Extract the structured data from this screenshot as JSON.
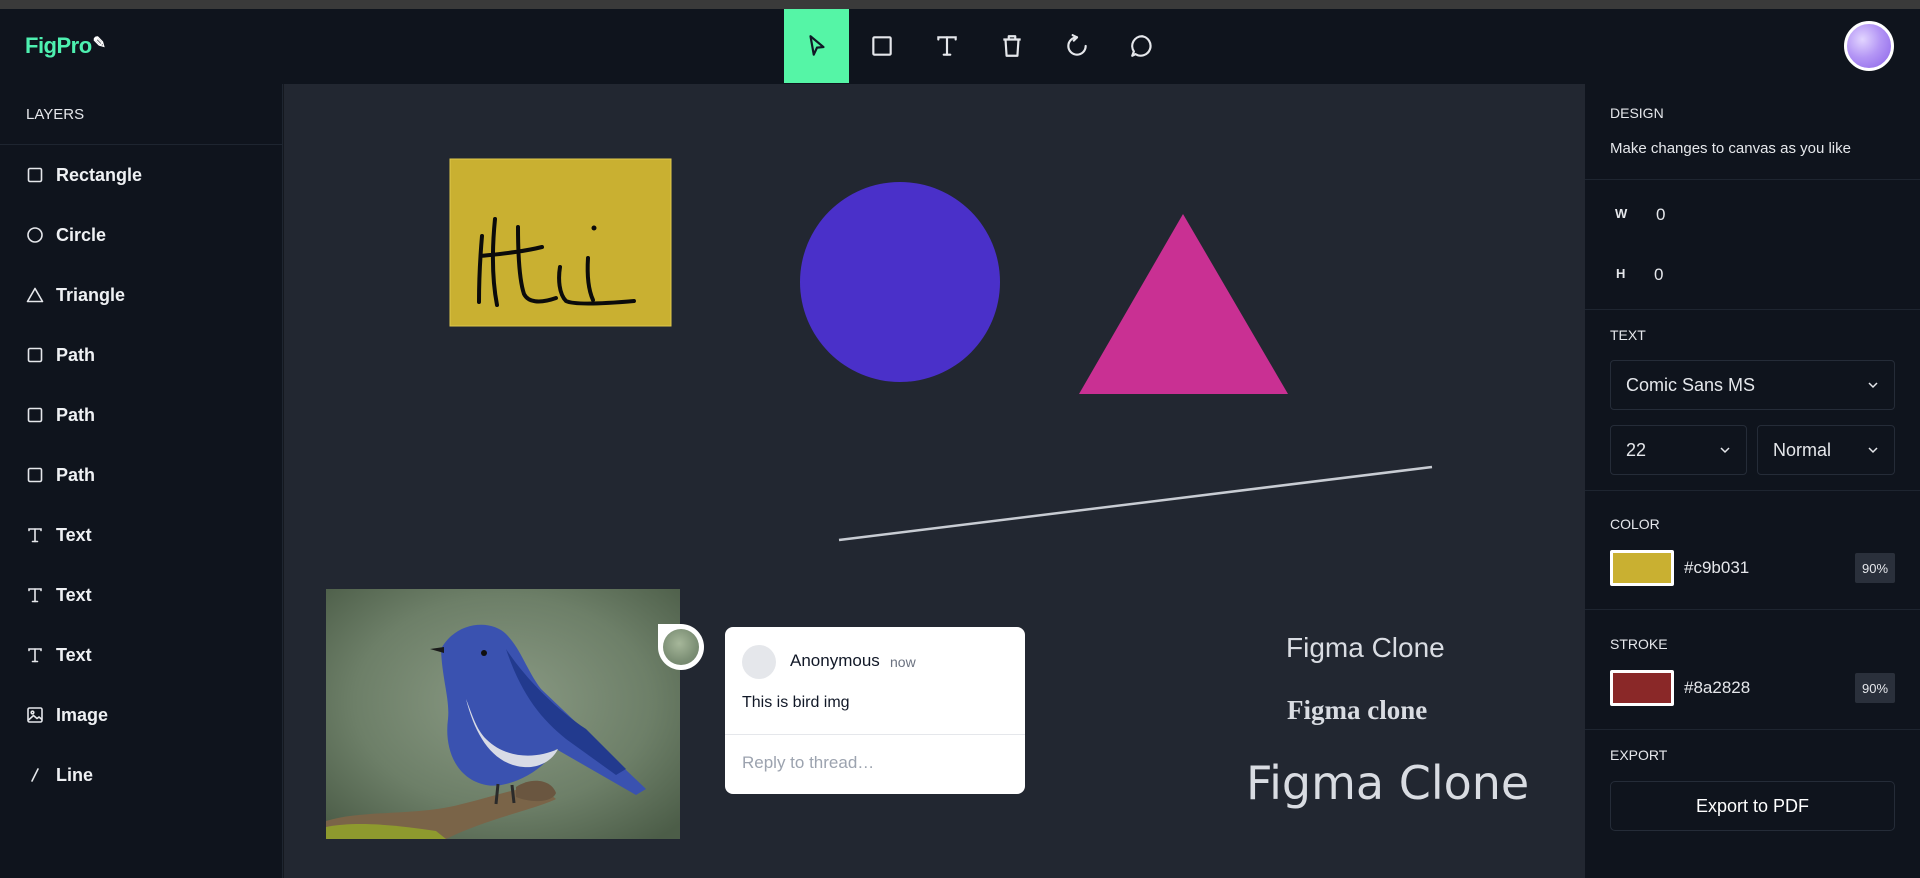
{
  "app": {
    "logo": "FigPro"
  },
  "toolbar": {
    "tools": [
      {
        "name": "select",
        "icon": "cursor-icon",
        "active": true
      },
      {
        "name": "rectangle",
        "icon": "rectangle-icon",
        "active": false
      },
      {
        "name": "text",
        "icon": "text-icon",
        "active": false
      },
      {
        "name": "delete",
        "icon": "trash-icon",
        "active": false
      },
      {
        "name": "reset",
        "icon": "refresh-icon",
        "active": false
      },
      {
        "name": "comments",
        "icon": "comment-icon",
        "active": false
      }
    ]
  },
  "layers": {
    "title": "LAYERS",
    "items": [
      {
        "label": "Rectangle",
        "icon": "square-icon"
      },
      {
        "label": "Circle",
        "icon": "circle-icon"
      },
      {
        "label": "Triangle",
        "icon": "triangle-icon"
      },
      {
        "label": "Path",
        "icon": "square-icon"
      },
      {
        "label": "Path",
        "icon": "square-icon"
      },
      {
        "label": "Path",
        "icon": "square-icon"
      },
      {
        "label": "Text",
        "icon": "text-icon"
      },
      {
        "label": "Text",
        "icon": "text-icon"
      },
      {
        "label": "Text",
        "icon": "text-icon"
      },
      {
        "label": "Image",
        "icon": "image-icon"
      },
      {
        "label": "Line",
        "icon": "line-icon"
      }
    ]
  },
  "canvas": {
    "rectangle_color": "#c9b031",
    "circle_color": "#4a30c9",
    "triangle_color": "#c93093",
    "drawing_text": "Hi",
    "texts": [
      "Figma Clone",
      "Figma clone",
      "Figma Clone"
    ]
  },
  "comment": {
    "author": "Anonymous",
    "time": "now",
    "body": "This is bird img",
    "reply_placeholder": "Reply to thread…"
  },
  "design": {
    "title": "DESIGN",
    "subtitle": "Make changes to canvas as you like",
    "width_label": "W",
    "width_value": "0",
    "height_label": "H",
    "height_value": "0",
    "text_title": "TEXT",
    "font_family": "Comic Sans MS",
    "font_size": "22",
    "font_weight": "Normal",
    "color_title": "COLOR",
    "fill_hex": "#c9b031",
    "fill_opacity": "90%",
    "stroke_title": "STROKE",
    "stroke_hex": "#8a2828",
    "stroke_opacity": "90%",
    "export_title": "EXPORT",
    "export_label": "Export to PDF"
  }
}
